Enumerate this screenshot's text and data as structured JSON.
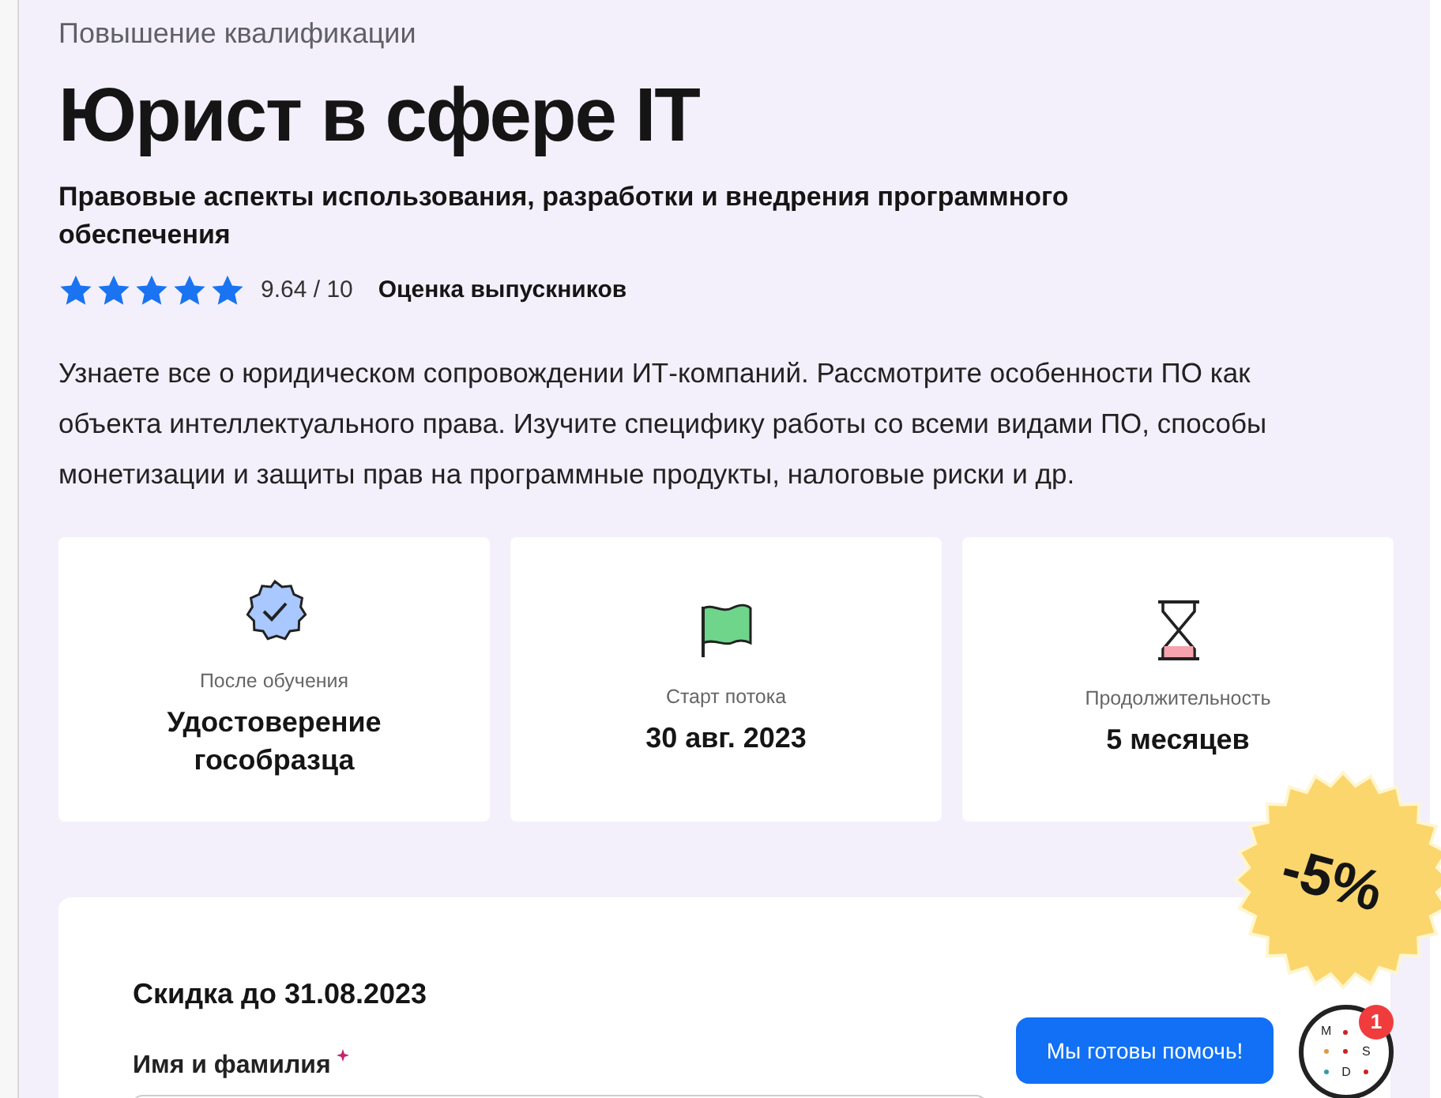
{
  "hero": {
    "eyebrow": "Повышение квалификации",
    "title": "Юрист в сфере IT",
    "subtitle": "Правовые аспекты использования, разработки и внедрения программного обеспечения",
    "rating": {
      "stars": 5,
      "score": "9.64 / 10",
      "label": "Оценка выпускников"
    },
    "description": "Узнаете все о юридическом сопровождении ИТ-компаний. Рассмотрите особенности ПО как объекта интеллектуального права. Изучите специфику работы со всеми видами ПО, способы монетизации и защиты прав на программные продукты, налоговые риски и др."
  },
  "facts": [
    {
      "kind": "certificate",
      "label": "После обучения",
      "value": "Удостоверение гособразца"
    },
    {
      "kind": "flag",
      "label": "Старт потока",
      "value": "30 авг. 2023"
    },
    {
      "kind": "hourglass",
      "label": "Продолжительность",
      "value": "5 месяцев"
    }
  ],
  "discount_badge": "-5%",
  "form": {
    "title": "Скидка до 31.08.2023",
    "fields": [
      {
        "label": "Имя и фамилия",
        "required": true
      }
    ]
  },
  "help_button": "Мы готовы помочь!",
  "chat_widget": {
    "letters": [
      "M",
      "S",
      "D"
    ],
    "badge": "1"
  }
}
